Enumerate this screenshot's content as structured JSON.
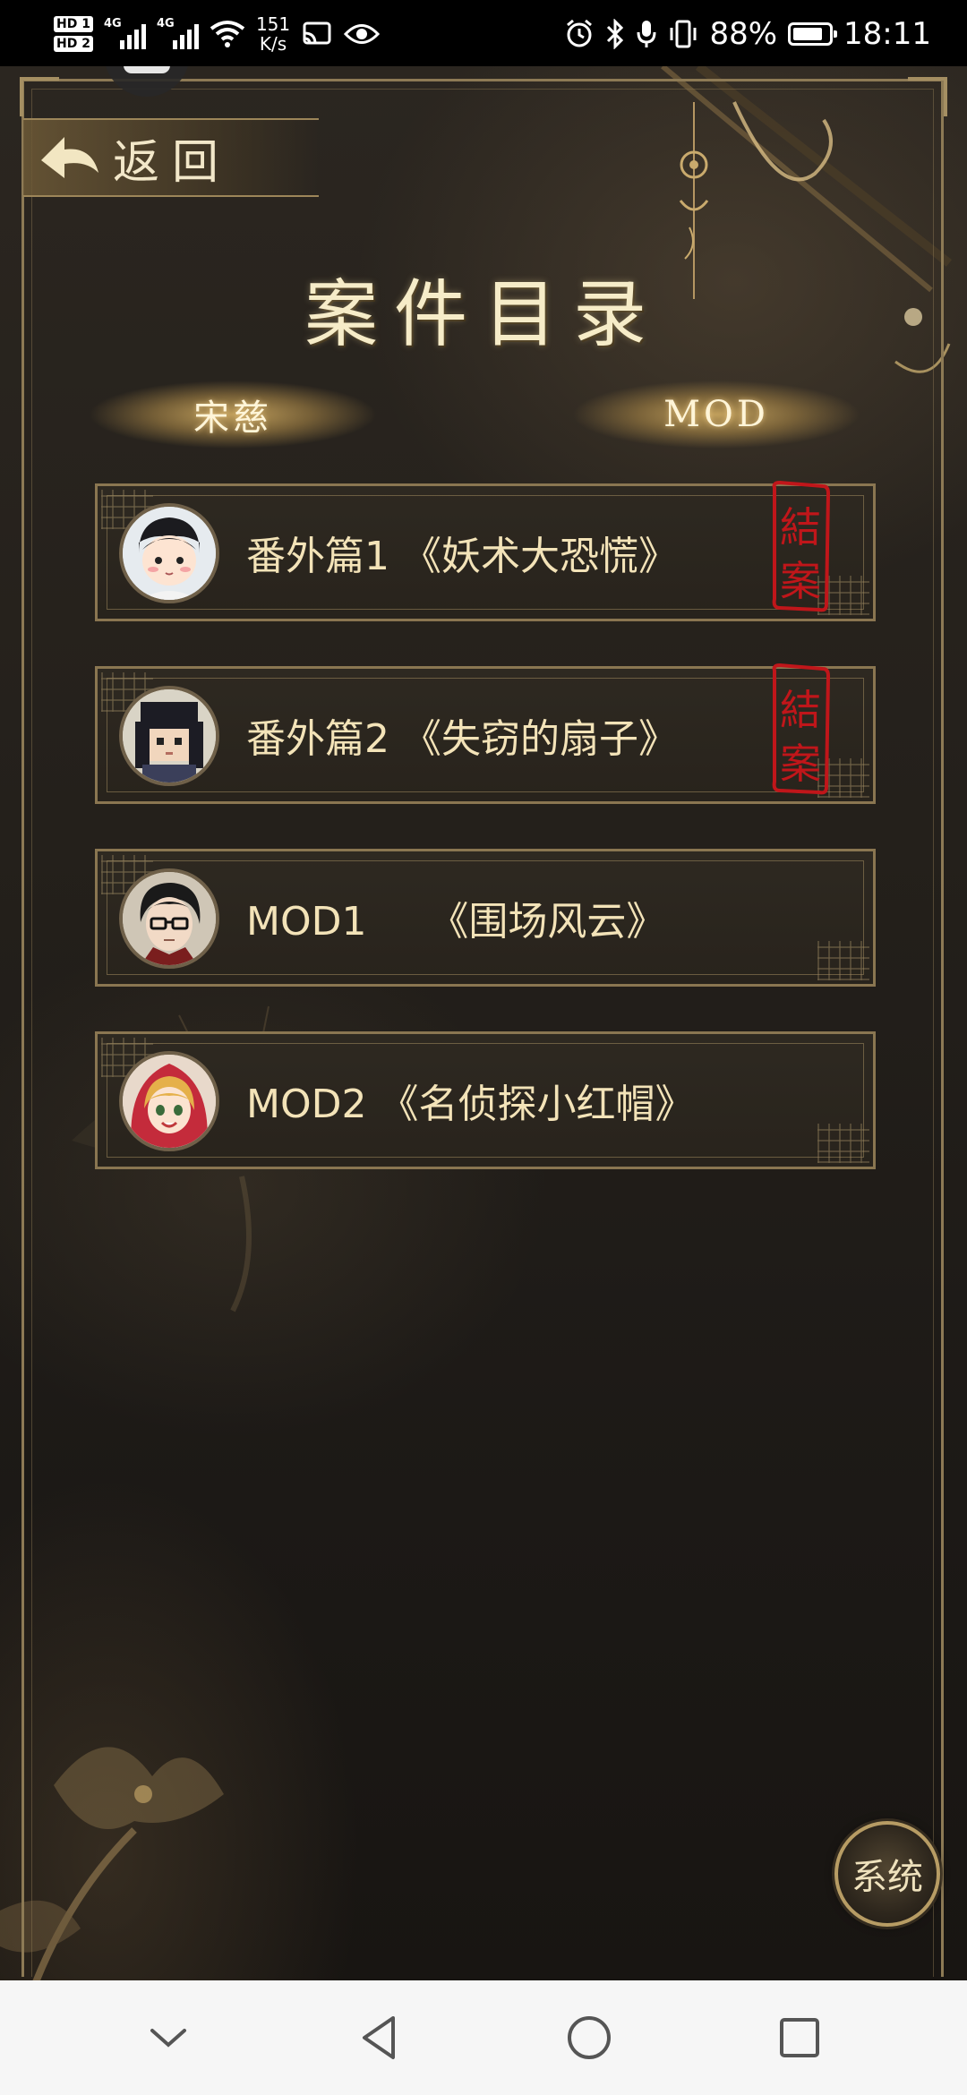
{
  "status_bar": {
    "sim1": "HD 1",
    "sim2": "HD 2",
    "network1": "4G",
    "network2": "4G",
    "speed_value": "151",
    "speed_unit": "K/s",
    "battery_percent": "88%",
    "time": "18:11",
    "icons": [
      "wifi-icon",
      "cast-icon",
      "eye-icon",
      "alarm-icon",
      "bluetooth-icon",
      "mic-icon",
      "vibrate-icon",
      "battery-icon"
    ]
  },
  "game": {
    "back_label": "返回",
    "title": "案件目录",
    "tabs": [
      {
        "label": "宋慈"
      },
      {
        "label": "MOD"
      }
    ],
    "cases": [
      {
        "label": "番外篇1 《妖术大恐慌》",
        "closed": true,
        "stamp_text": "結案",
        "avatar": "boy-scholar-avatar"
      },
      {
        "label": "番外篇2 《失窃的扇子》",
        "closed": true,
        "stamp_text": "結案",
        "avatar": "pixel-woman-avatar"
      },
      {
        "label": "MOD1     《围场风云》",
        "closed": false,
        "stamp_text": "",
        "avatar": "glasses-man-avatar"
      },
      {
        "label": "MOD2 《名侦探小红帽》",
        "closed": false,
        "stamp_text": "",
        "avatar": "red-hood-girl-avatar"
      }
    ],
    "system_label": "系统"
  },
  "colors": {
    "gold_text": "#f3e3b8",
    "frame_gold": "#8a7651",
    "stamp_red": "#c0161a",
    "background": "#24201b"
  }
}
